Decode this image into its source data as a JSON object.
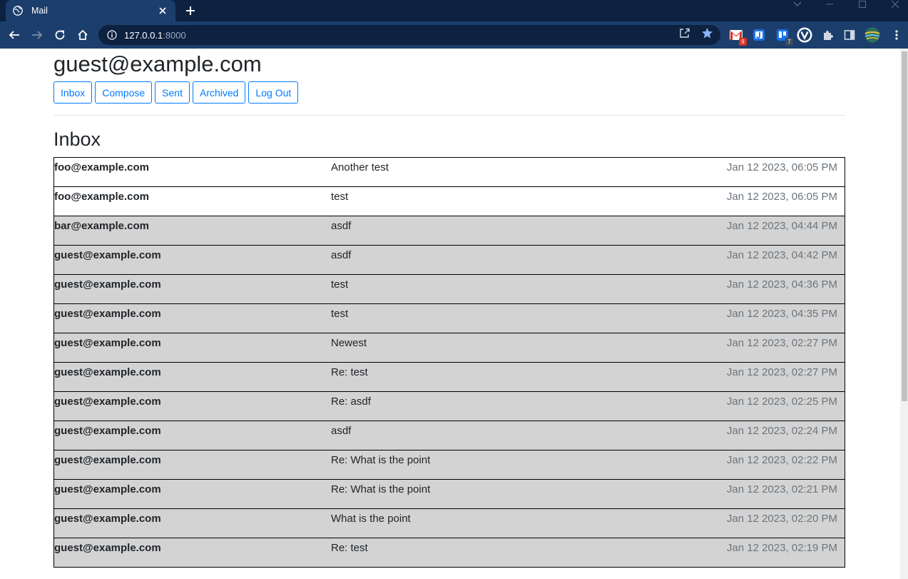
{
  "browser": {
    "tab_title": "Mail",
    "url_host": "127.0.0.1",
    "url_port": ":8000",
    "extensions": [
      {
        "name": "gmail-extension",
        "badge": "9",
        "color": "#d93025"
      },
      {
        "name": "j-extension",
        "badge": "",
        "color": "#1a73e8"
      },
      {
        "name": "trello-extension",
        "badge": "7",
        "color": "#1a73e8"
      },
      {
        "name": "v-extension",
        "badge": "",
        "color": "#ffffff"
      }
    ]
  },
  "header": {
    "user_email": "guest@example.com"
  },
  "nav": {
    "inbox": "Inbox",
    "compose": "Compose",
    "sent": "Sent",
    "archived": "Archived",
    "logout": "Log Out"
  },
  "mailbox": {
    "title": "Inbox"
  },
  "emails": [
    {
      "sender": "foo@example.com",
      "subject": "Another test",
      "timestamp": "Jan 12 2023, 06:05 PM",
      "read": false
    },
    {
      "sender": "foo@example.com",
      "subject": "test",
      "timestamp": "Jan 12 2023, 06:05 PM",
      "read": false
    },
    {
      "sender": "bar@example.com",
      "subject": "asdf",
      "timestamp": "Jan 12 2023, 04:44 PM",
      "read": true
    },
    {
      "sender": "guest@example.com",
      "subject": "asdf",
      "timestamp": "Jan 12 2023, 04:42 PM",
      "read": true
    },
    {
      "sender": "guest@example.com",
      "subject": "test",
      "timestamp": "Jan 12 2023, 04:36 PM",
      "read": true
    },
    {
      "sender": "guest@example.com",
      "subject": "test",
      "timestamp": "Jan 12 2023, 04:35 PM",
      "read": true
    },
    {
      "sender": "guest@example.com",
      "subject": "Newest",
      "timestamp": "Jan 12 2023, 02:27 PM",
      "read": true
    },
    {
      "sender": "guest@example.com",
      "subject": "Re: test",
      "timestamp": "Jan 12 2023, 02:27 PM",
      "read": true
    },
    {
      "sender": "guest@example.com",
      "subject": "Re: asdf",
      "timestamp": "Jan 12 2023, 02:25 PM",
      "read": true
    },
    {
      "sender": "guest@example.com",
      "subject": "asdf",
      "timestamp": "Jan 12 2023, 02:24 PM",
      "read": true
    },
    {
      "sender": "guest@example.com",
      "subject": "Re: What is the point",
      "timestamp": "Jan 12 2023, 02:22 PM",
      "read": true
    },
    {
      "sender": "guest@example.com",
      "subject": "Re: What is the point",
      "timestamp": "Jan 12 2023, 02:21 PM",
      "read": true
    },
    {
      "sender": "guest@example.com",
      "subject": "What is the point",
      "timestamp": "Jan 12 2023, 02:20 PM",
      "read": true
    },
    {
      "sender": "guest@example.com",
      "subject": "Re: test",
      "timestamp": "Jan 12 2023, 02:19 PM",
      "read": true
    }
  ]
}
